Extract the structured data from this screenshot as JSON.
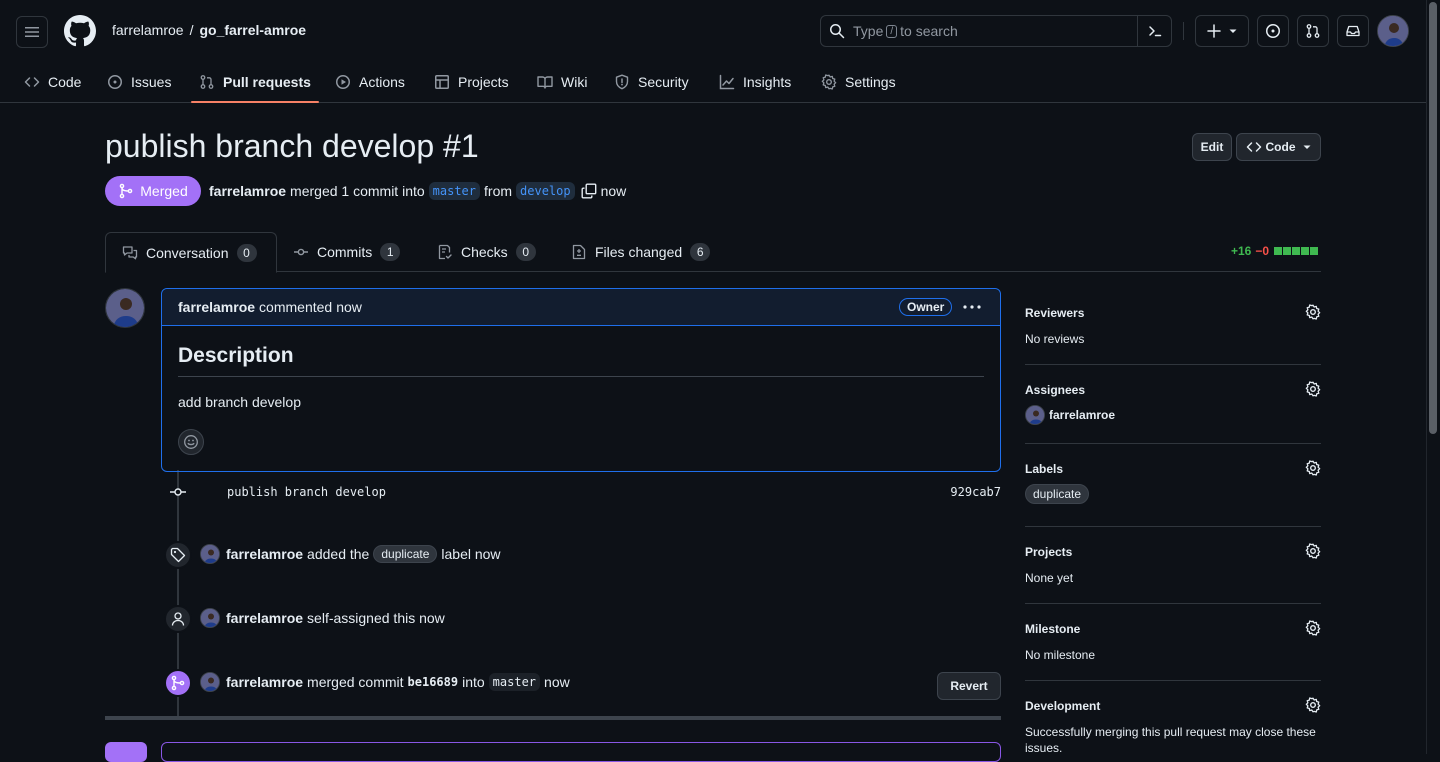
{
  "header": {
    "owner": "farrelamroe",
    "separator": "/",
    "repo": "go_farrel-amroe",
    "search_prefix": "Type",
    "search_key": "/",
    "search_suffix": "to search"
  },
  "repo_nav": [
    {
      "label": "Code",
      "icon": "code-icon"
    },
    {
      "label": "Issues",
      "icon": "issue-icon"
    },
    {
      "label": "Pull requests",
      "icon": "pull-request-icon"
    },
    {
      "label": "Actions",
      "icon": "play-icon"
    },
    {
      "label": "Projects",
      "icon": "table-icon"
    },
    {
      "label": "Wiki",
      "icon": "book-icon"
    },
    {
      "label": "Security",
      "icon": "shield-icon"
    },
    {
      "label": "Insights",
      "icon": "graph-icon"
    },
    {
      "label": "Settings",
      "icon": "gear-icon"
    }
  ],
  "pr": {
    "title": "publish branch develop #1",
    "edit_label": "Edit",
    "code_label": "Code",
    "state": "Merged",
    "author": "farrelamroe",
    "meta_mid": "merged 1 commit into",
    "base_branch": "master",
    "from_word": "from",
    "head_branch": "develop",
    "when": "now"
  },
  "tabs": [
    {
      "label": "Conversation",
      "count": "0"
    },
    {
      "label": "Commits",
      "count": "1"
    },
    {
      "label": "Checks",
      "count": "0"
    },
    {
      "label": "Files changed",
      "count": "6"
    }
  ],
  "diffstat": {
    "additions": "+16",
    "deletions": "−0",
    "boxes": 5,
    "color_add": "#3fb950",
    "color_del": "#f85149"
  },
  "comment": {
    "author": "farrelamroe",
    "action": "commented",
    "when": "now",
    "role": "Owner",
    "heading": "Description",
    "body": "add branch develop"
  },
  "commit": {
    "message": "publish branch develop",
    "sha": "929cab7"
  },
  "events": {
    "label": {
      "who": "farrelamroe",
      "pre": "added the",
      "label": "duplicate",
      "post": "label now"
    },
    "assign": {
      "who": "farrelamroe",
      "text": "self-assigned this now"
    },
    "merge": {
      "who": "farrelamroe",
      "pre": "merged commit",
      "sha": "be16689",
      "mid": "into",
      "branch": "master",
      "post": "now",
      "revert_label": "Revert"
    }
  },
  "sidebar": {
    "reviewers": {
      "title": "Reviewers",
      "value": "No reviews"
    },
    "assignees": {
      "title": "Assignees",
      "value": "farrelamroe"
    },
    "labels": {
      "title": "Labels",
      "value": "duplicate"
    },
    "projects": {
      "title": "Projects",
      "value": "None yet"
    },
    "milestone": {
      "title": "Milestone",
      "value": "No milestone"
    },
    "development": {
      "title": "Development",
      "value": "Successfully merging this pull request may close these issues."
    }
  },
  "colors": {
    "accent_merged": "#a371f7",
    "link_blue": "#4493f8",
    "nav_underline": "#f78166"
  }
}
